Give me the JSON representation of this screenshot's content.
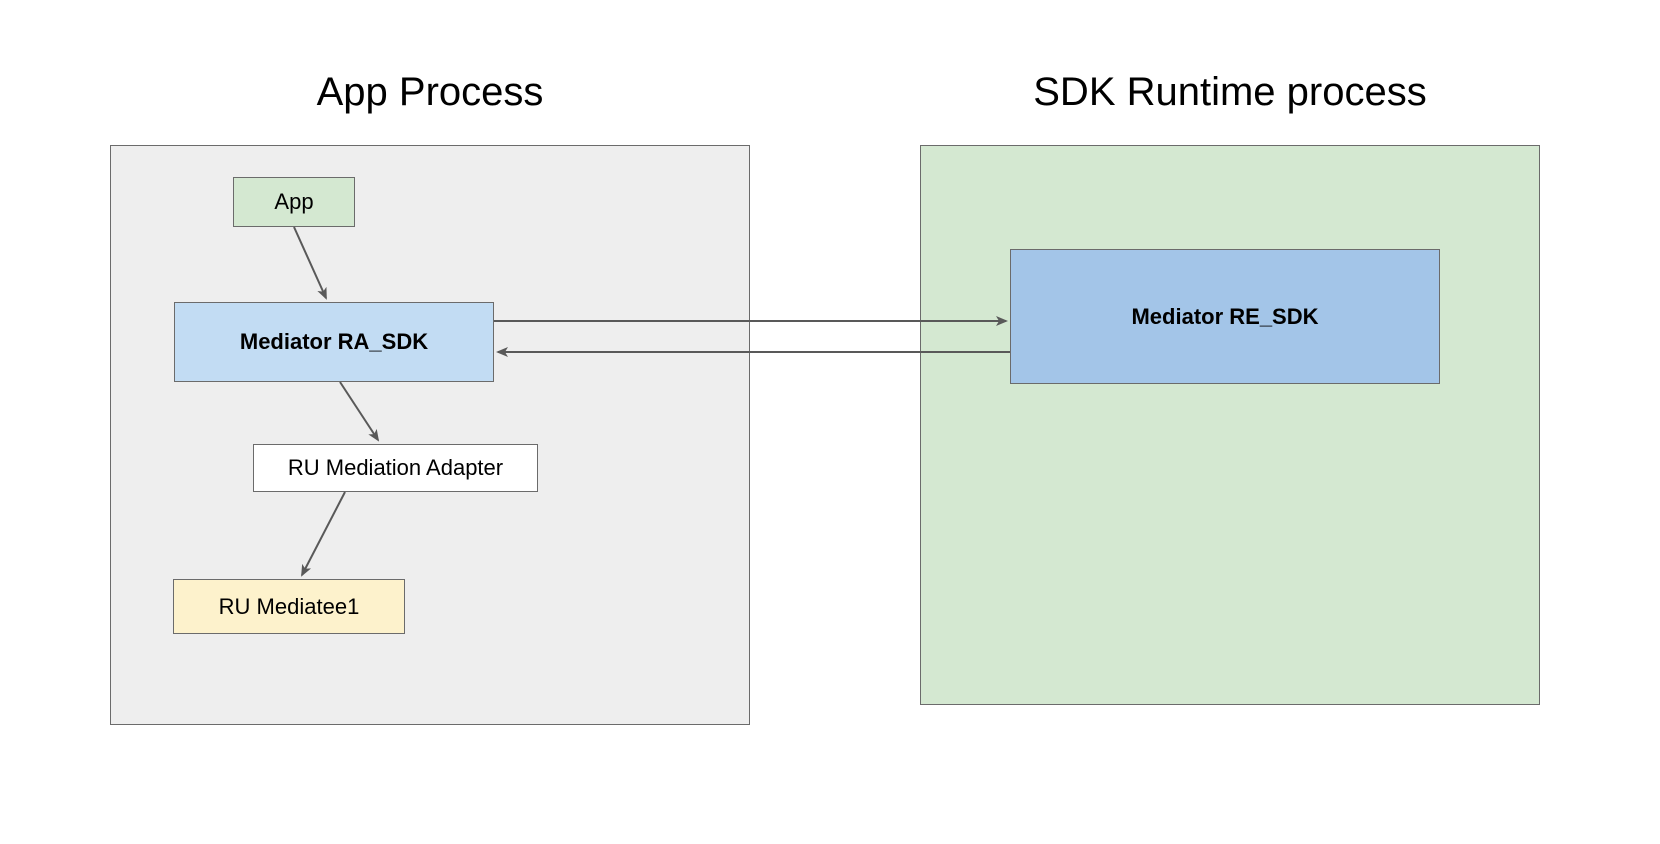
{
  "titles": {
    "app_process": "App Process",
    "sdk_runtime": "SDK Runtime process"
  },
  "nodes": {
    "app": "App",
    "mediator_ra": "Mediator RA_SDK",
    "ru_adapter": "RU Mediation Adapter",
    "ru_mediatee": "RU Mediatee1",
    "mediator_re": "Mediator RE_SDK"
  },
  "colors": {
    "app_process_bg": "#eeeeee",
    "sdk_runtime_bg": "#d4e8d1",
    "app_bg": "#d4e8d1",
    "mediator_ra_bg": "#c2dcf3",
    "ru_adapter_bg": "#ffffff",
    "ru_mediatee_bg": "#fdf2cc",
    "mediator_re_bg": "#a3c5e8",
    "border": "#6b6b6b",
    "arrow": "#595959"
  }
}
